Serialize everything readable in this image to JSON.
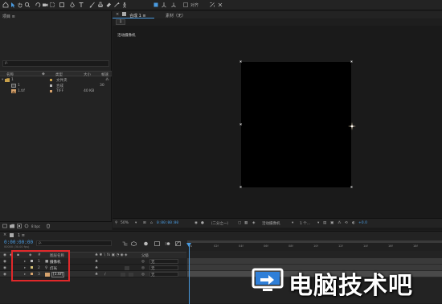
{
  "toolbar": {
    "snap_label": "对齐"
  },
  "project_panel": {
    "tab_label": "项目 ≡",
    "search_placeholder": "ρ.",
    "columns": {
      "name": "名称",
      "type": "类型",
      "size": "大小",
      "fps": "帧速"
    },
    "items": [
      {
        "name": "1",
        "type": "文件夹",
        "size": "",
        "color": "#c8a04a",
        "extra": ""
      },
      {
        "name": "1",
        "type": "合成",
        "size": "",
        "color": "#b8b8b8",
        "extra": "30"
      },
      {
        "name": "1.tif",
        "type": "TIFF",
        "size": "40 KB",
        "color": "#d6a26c",
        "extra": ""
      }
    ],
    "bpc": "8 bpc"
  },
  "comp_panel": {
    "tab_label": "合成 1 ≡",
    "footage_tab": "素材（无）",
    "breadcrumb": "1",
    "viewer_label": "活动摄像机",
    "footer": {
      "zoom": "50%",
      "resolution": "（二分之一）",
      "camera": "活动摄像机",
      "views": "1 个...",
      "exposure": "+0.0"
    }
  },
  "timeline": {
    "tab_label": "1 ≡",
    "timecode": "0:00:00:00",
    "frames": "00000 (30.00 fps)",
    "search_placeholder": "ρ.",
    "header": {
      "num": "#",
      "layer_name": "图层名称",
      "mode": "父级"
    },
    "layers": [
      {
        "index": "1",
        "name": "摄像机",
        "parent": "无",
        "color": "#b8b8b8"
      },
      {
        "index": "2",
        "name": "灯光",
        "parent": "无",
        "color": "#d8c476"
      },
      {
        "index": "3",
        "name": "[1.tif]",
        "parent": "无",
        "color": "#d6a26c"
      }
    ],
    "ruler_ticks": [
      "0s",
      "02f",
      "04f",
      "06f",
      "08f",
      "10f",
      "12f",
      "14f",
      "16f",
      "18f"
    ]
  },
  "watermark": {
    "text": "电脑技术吧"
  },
  "colors": {
    "accent": "#4a9be0",
    "highlight_box": "#e0282a"
  }
}
